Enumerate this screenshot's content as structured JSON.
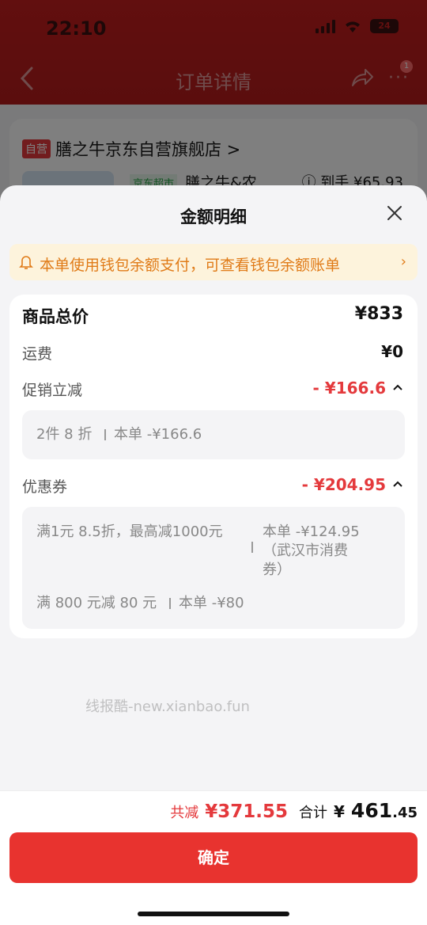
{
  "status_bar": {
    "time": "22:10",
    "battery": "24"
  },
  "navbar": {
    "title": "订单详情",
    "badge": "1"
  },
  "background_card": {
    "store_tag": "自营",
    "store_name": "膳之牛京东自营旗舰店 >",
    "product_tag": "京东超市",
    "product_name": "膳之牛&农...",
    "price_label": "ⓘ 到手 ¥65.93"
  },
  "sheet": {
    "title": "金额明细",
    "notice": "本单使用钱包余额支付，可查看钱包余额账单",
    "rows": {
      "goods_total": {
        "label": "商品总价",
        "value": "¥833"
      },
      "shipping": {
        "label": "运费",
        "value": "¥0"
      },
      "promotion": {
        "label": "促销立减",
        "value": "- ¥166.6"
      },
      "coupon": {
        "label": "优惠券",
        "value": "- ¥204.95"
      }
    },
    "promotion_detail": {
      "left": "2件 8 折",
      "right": "本单 -¥166.6"
    },
    "coupon_details": [
      {
        "left": "满1元 8.5折，最高减1000元",
        "right": "本单 -¥124.95（武汉市消费券）"
      },
      {
        "left": "满 800 元减 80 元",
        "right": "本单 -¥80"
      }
    ]
  },
  "watermark": "线报酷-new.xianbao.fun",
  "footer": {
    "save_label": "共减",
    "save_value": "¥371.55",
    "total_label": "合计",
    "total_currency": "¥",
    "total_int": "461",
    "total_dec": ".45",
    "confirm": "确定"
  },
  "colors": {
    "accent_red": "#e4393c",
    "notice_orange": "#e07b18",
    "header_red": "#c41e1e"
  }
}
